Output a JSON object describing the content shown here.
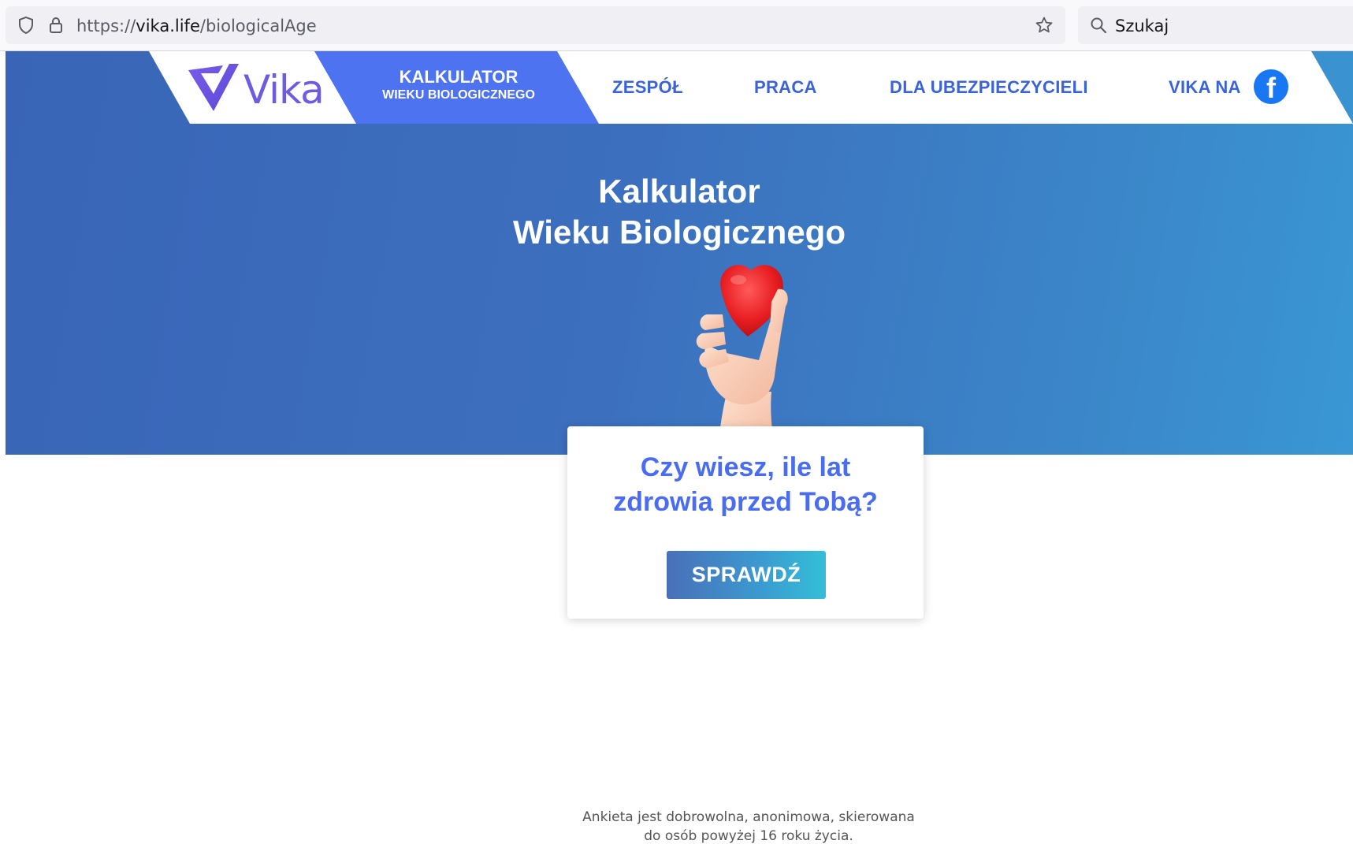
{
  "browser": {
    "url_scheme": "https://",
    "url_host": "vika.life",
    "url_path": "/biologicalAge",
    "search_placeholder": "Szukaj"
  },
  "nav": {
    "logo_text": "Vika",
    "active_item": {
      "line1": "KALKULATOR",
      "line2": "WIEKU BIOLOGICZNEGO"
    },
    "items": [
      {
        "label": "ZESPÓŁ"
      },
      {
        "label": "PRACA"
      },
      {
        "label": "DLA UBEZPIECZYCIELI"
      },
      {
        "label": "VIKA NA"
      }
    ],
    "facebook_icon": "facebook-icon"
  },
  "hero": {
    "title_line1": "Kalkulator",
    "title_line2": "Wieku Biologicznego",
    "image": "hand-holding-heart"
  },
  "card": {
    "question_line1": "Czy wiesz, ile lat",
    "question_line2": "zdrowia przed Tobą?",
    "button_label": "SPRAWDŹ"
  },
  "footer": {
    "disclaimer_line1": "Ankieta jest dobrowolna, anonimowa, skierowana",
    "disclaimer_line2": "do osób powyżej 16 roku życia."
  },
  "colors": {
    "brand_purple": "#6c5ce0",
    "nav_blue": "#4e73f0",
    "nav_text": "#3a63d8",
    "hero_gradient_start": "#3a65b7",
    "hero_gradient_end": "#3a97d4",
    "question_text": "#4a6cf0",
    "facebook_blue": "#1877f2"
  }
}
